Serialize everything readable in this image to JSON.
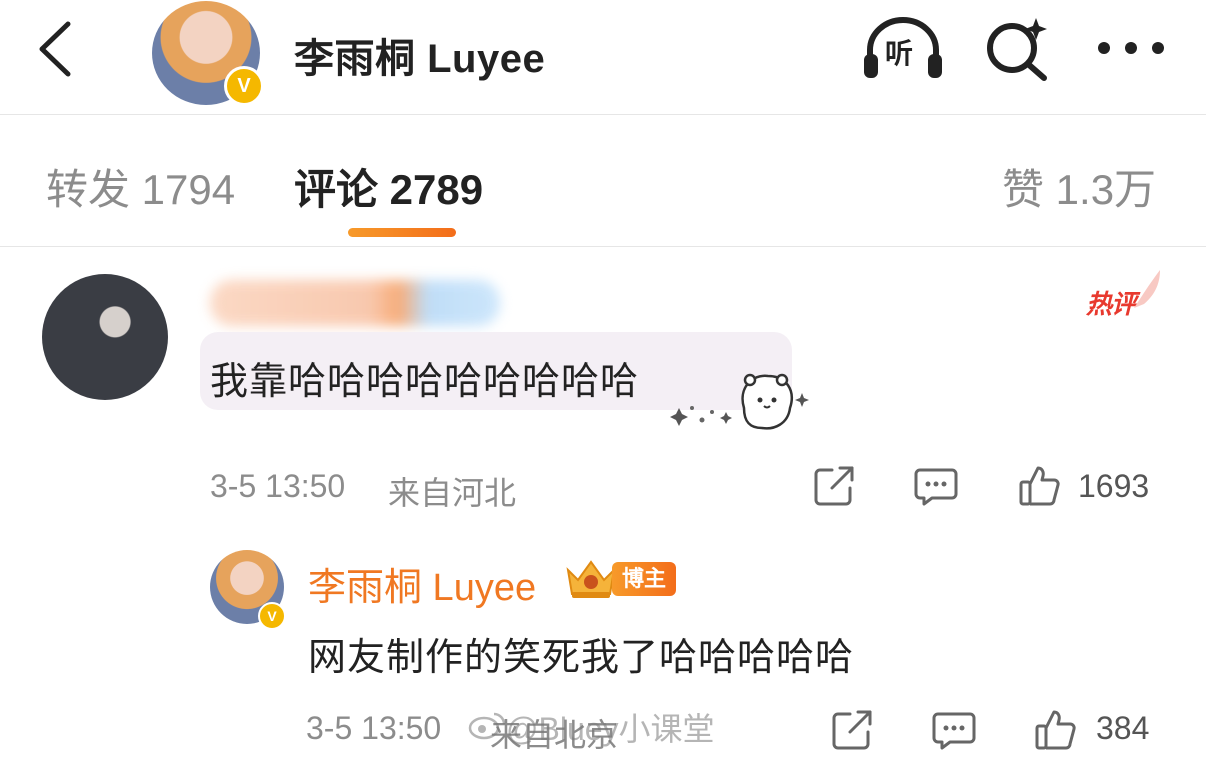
{
  "header": {
    "title": "李雨桐 Luyee",
    "listen_label": "听",
    "icons": {
      "back": "chevron-left-icon",
      "listen": "headphones-icon",
      "search": "search-sparkle-icon",
      "more": "more-dots-icon"
    }
  },
  "tabs": {
    "repost": "转发 1794",
    "comment": "评论 2789",
    "like": "赞 1.3万"
  },
  "comment1": {
    "hot_tag": "热评",
    "text": "我靠哈哈哈哈哈哈哈哈哈",
    "time": "3-5 13:50",
    "location": "来自河北",
    "likes": "1693"
  },
  "reply": {
    "name": "李雨桐 Luyee",
    "badge": "博主",
    "text": "网友制作的笑死我了哈哈哈哈哈",
    "time": "3-5 13:50",
    "location": "来自北京",
    "likes": "384"
  },
  "watermark": "@Bluey小课堂",
  "colors": {
    "accent_orange": "#f07822",
    "hot_red": "#e8392e",
    "verify_gold": "#f5b800",
    "muted_text": "#8c8c8c"
  }
}
